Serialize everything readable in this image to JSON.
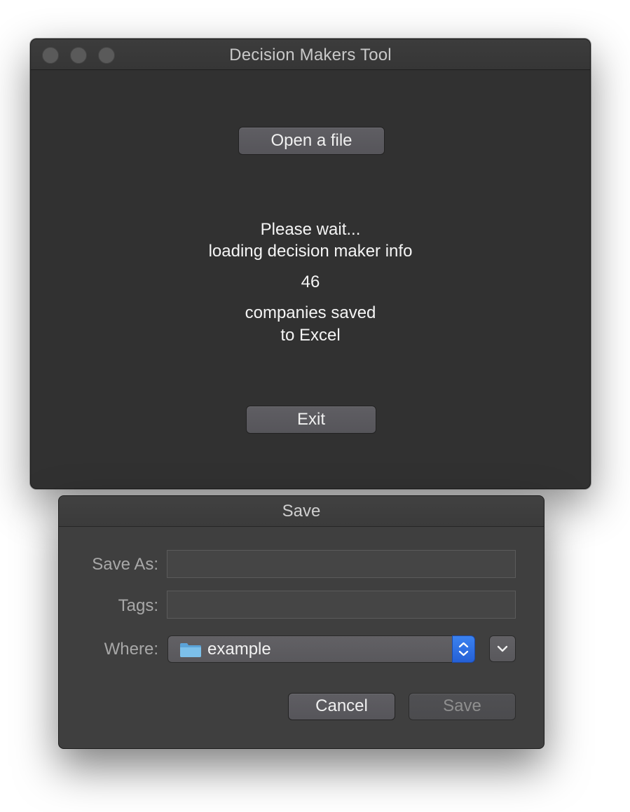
{
  "main_window": {
    "title": "Decision Makers Tool",
    "open_button_label": "Open a file",
    "status_line_1": "Please wait...",
    "status_line_2": "loading decision maker info",
    "count": "46",
    "saved_line_1": "companies saved",
    "saved_line_2": "to Excel",
    "exit_button_label": "Exit"
  },
  "save_dialog": {
    "title": "Save",
    "save_as_label": "Save As:",
    "save_as_value": "",
    "tags_label": "Tags:",
    "tags_value": "",
    "where_label": "Where:",
    "where_value": "example",
    "cancel_label": "Cancel",
    "save_label": "Save"
  },
  "icons": {
    "window_controls": [
      "close-button-icon",
      "minimize-button-icon",
      "zoom-button-icon"
    ],
    "where_popup_icon": "folder-icon",
    "stepper_icon": "up-down-chevron-icon",
    "expand_icon": "chevron-down-icon"
  },
  "colors": {
    "window_background": "#313131",
    "sheet_background": "#3f3f3f",
    "accent_blue": "#2f6fe4",
    "text_primary": "#f5f5f5",
    "text_label": "#a8a8a8",
    "disabled_text": "#8f8f8f"
  }
}
